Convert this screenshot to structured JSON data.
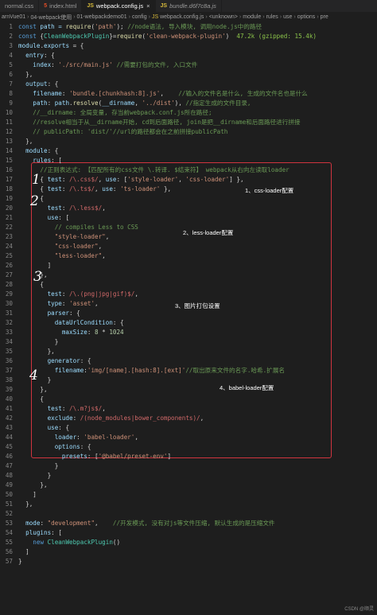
{
  "tabs": [
    {
      "icon": "css-file-icon",
      "label": "normal.css",
      "active": false
    },
    {
      "icon": "html-file-icon",
      "label": "index.html",
      "active": false
    },
    {
      "icon": "js-file-icon",
      "label": "webpack.config.js",
      "active": true
    },
    {
      "icon": "js-file-icon",
      "label": "bundle.d6f7c8a.js",
      "active": false
    }
  ],
  "tab_icon_text": {
    "html": "5",
    "js": "JS",
    "css": "#"
  },
  "breadcrumb": [
    "arnVue01",
    "04-webpack使用",
    "01-webpackdemo01",
    "config",
    "webpack.config.js",
    "<unknown>",
    "module",
    "rules",
    "use",
    "options",
    "pre"
  ],
  "annotations": {
    "a1": "1、css-loader配置",
    "a2": "2、less-loader配置",
    "a3": "3、图片打包设置",
    "a4": "4、babel-loader配置"
  },
  "hand_numbers": {
    "n1": "1",
    "n2": "2",
    "n3": "3",
    "n4": "4"
  },
  "watermark": "CSDN @顺灵",
  "code": {
    "l1_a": "const",
    "l1_b": " path = ",
    "l1_c": "require",
    "l1_d": "(",
    "l1_e": "'path'",
    "l1_f": "); ",
    "l1_g": "//node语法, 导入模块, 调用node.js中的路径",
    "l2_a": "const",
    "l2_b": " {",
    "l2_c": "CleanWebpackPlugin",
    "l2_d": "}=",
    "l2_e": "require",
    "l2_f": "(",
    "l2_g": "'clean-webpack-plugin'",
    "l2_h": ")",
    "l2_i": "  47.2k (gzipped: 15.4k)",
    "l3_a": "module",
    "l3_b": ".",
    "l3_c": "exports",
    "l3_d": " = {",
    "l4_a": "  entry",
    "l4_b": ": {",
    "l5_a": "    index",
    "l5_b": ": ",
    "l5_c": "'./src/main.js'",
    "l5_d": " ",
    "l5_e": "//需要打包的文件, 入口文件",
    "l6": "  },",
    "l7_a": "  output",
    "l7_b": ": {",
    "l8_a": "    filename",
    "l8_b": ": ",
    "l8_c": "'bundle.[chunkhash:8].js'",
    "l8_d": ",    ",
    "l8_e": "//输入的文件名是什么, 生成的文件名也是什么",
    "l9_a": "    path",
    "l9_b": ": ",
    "l9_c": "path",
    "l9_d": ".",
    "l9_e": "resolve",
    "l9_f": "(",
    "l9_g": "__dirname",
    "l9_h": ", ",
    "l9_i": "'../dist'",
    "l9_j": "), ",
    "l9_k": "//指定生成的文件目录,",
    "l10": "    //__dirname: 全局变量, 存当前webpack.conf.js所在路径;",
    "l11": "    //resolve相当于从__dirname开始, cd到后面路径, join是把__dirname和后面路径进行拼接",
    "l12": "    // publicPath: 'dist/'//url的路径都会在之前拼接publicPath",
    "l13": "  },",
    "l14_a": "  module",
    "l14_b": ": {",
    "l15_a": "    rules",
    "l15_b": ": [",
    "l16": "      //正则表达式: 【匹配所有的css文件 \\.转译. $结束符】 webpack从右向左读取loader",
    "l17_a": "      { ",
    "l17_b": "test",
    "l17_c": ": ",
    "l17_d": "/\\.css$/",
    "l17_e": ", ",
    "l17_f": "use",
    "l17_g": ": [",
    "l17_h": "'style-loader'",
    "l17_i": ", ",
    "l17_j": "'css-loader'",
    "l17_k": "] },",
    "l18_a": "      { ",
    "l18_b": "test",
    "l18_c": ": ",
    "l18_d": "/\\.ts$/",
    "l18_e": ", ",
    "l18_f": "use",
    "l18_g": ": ",
    "l18_h": "'ts-loader'",
    "l18_i": " },",
    "l19": "      {",
    "l20_a": "        test",
    "l20_b": ": ",
    "l20_c": "/\\.less$/",
    "l20_d": ",",
    "l21_a": "        use",
    "l21_b": ": [",
    "l22": "          // compiles Less to CSS",
    "l23_a": "          ",
    "l23_b": "\"style-loader\"",
    "l23_c": ",",
    "l24_a": "          ",
    "l24_b": "\"css-loader\"",
    "l24_c": ",",
    "l25_a": "          ",
    "l25_b": "\"less-loader\"",
    "l25_c": ",",
    "l26": "        ]",
    "l27": "      },",
    "l28": "      {",
    "l29_a": "        test",
    "l29_b": ": ",
    "l29_c": "/\\.(png|jpg|gif)$/",
    "l29_d": ",",
    "l30_a": "        type",
    "l30_b": ": ",
    "l30_c": "'asset'",
    "l30_d": ",",
    "l31_a": "        parser",
    "l31_b": ": {",
    "l32_a": "          dataUrlCondition",
    "l32_b": ": {",
    "l33_a": "            maxSize",
    "l33_b": ": ",
    "l33_c": "8",
    "l33_d": " * ",
    "l33_e": "1024",
    "l34": "          }",
    "l35": "        },",
    "l36_a": "        generator",
    "l36_b": ": {",
    "l37_a": "          filename",
    "l37_b": ":",
    "l37_c": "'img/[name].[hash:8].[ext]'",
    "l37_d": "",
    "l37_e": "//取出原来文件的名字.哈希.扩展名",
    "l38": "        }",
    "l39": "      },",
    "l40": "      {",
    "l41_a": "        test",
    "l41_b": ": ",
    "l41_c": "/\\.m?js$/",
    "l41_d": ",",
    "l42_a": "        exclude",
    "l42_b": ": ",
    "l42_c": "/(node_modules|bower_components)/",
    "l42_d": ",",
    "l43_a": "        use",
    "l43_b": ": {",
    "l44_a": "          loader",
    "l44_b": ": ",
    "l44_c": "'babel-loader'",
    "l44_d": ",",
    "l45_a": "          options",
    "l45_b": ": {",
    "l46_a": "            presets",
    "l46_b": ": [",
    "l46_c": "'@babel/preset-env'",
    "l46_d": "]",
    "l47": "          }",
    "l48": "        }",
    "l49": "      },",
    "l50": "    ]",
    "l51": "  },",
    "l52": "",
    "l53_a": "  mode",
    "l53_b": ": ",
    "l53_c": "\"development\"",
    "l53_d": ",    ",
    "l53_e": "//开发模式, 没有对js等文件压缩, 默认生成的是压缩文件",
    "l54_a": "  plugins",
    "l54_b": ": [",
    "l55_a": "    ",
    "l55_b": "new",
    "l55_c": " ",
    "l55_d": "CleanWebpackPlugin",
    "l55_e": "()",
    "l56": "  ]",
    "l57": "}"
  }
}
